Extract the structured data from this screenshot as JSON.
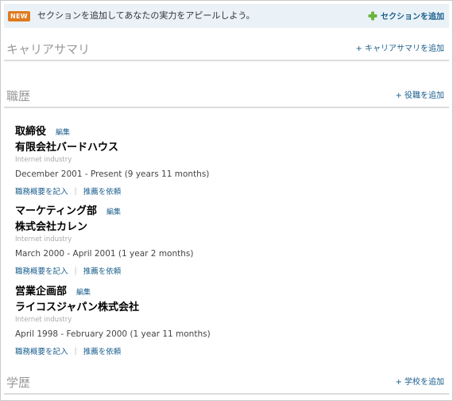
{
  "banner": {
    "badge": "NEW",
    "message": "セクションを追加してあなたの実力をアピールしよう。",
    "add_section": "セクションを追加"
  },
  "sections": {
    "career_summary": {
      "title": "キャリアサマリ",
      "add_link": "+ キャリアサマリを追加"
    },
    "experience": {
      "title": "職歴",
      "add_link": "+ 役職を追加"
    },
    "education": {
      "title": "学歴",
      "add_link": "+ 学校を追加"
    }
  },
  "positions": [
    {
      "title": "取締役",
      "edit": "編集",
      "company": "有限会社バードハウス",
      "industry": "Internet industry",
      "dates": "December 2001 - Present (9 years 11 months)",
      "describe_link": "職務概要を記入",
      "recommend_link": "推薦を依頼"
    },
    {
      "title": "マーケティング部",
      "edit": "編集",
      "company": "株式会社カレン",
      "industry": "Internet industry",
      "dates": "March 2000 - April 2001 (1 year 2 months)",
      "describe_link": "職務概要を記入",
      "recommend_link": "推薦を依頼"
    },
    {
      "title": "営業企画部",
      "edit": "編集",
      "company": "ライコスジャパン株式会社",
      "industry": "Internet industry",
      "dates": "April 1998 - February 2000 (1 year 11 months)",
      "describe_link": "職務概要を記入",
      "recommend_link": "推薦を依頼"
    }
  ],
  "colors": {
    "link": "#1a5e8c",
    "banner_bg": "#eaf2f8",
    "badge": "#e07a1f",
    "plus_icon": "#6cb33f",
    "section_title": "#999999"
  }
}
